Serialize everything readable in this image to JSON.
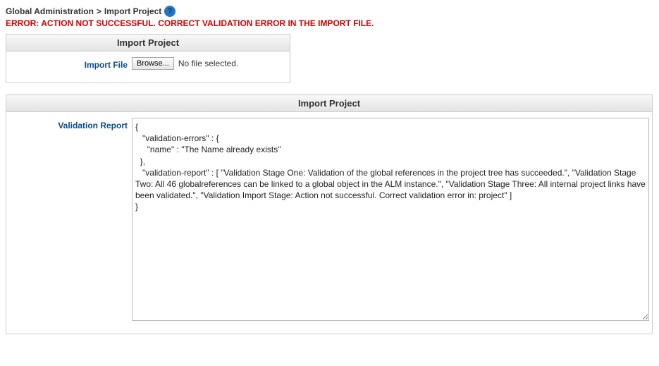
{
  "breadcrumb": {
    "parent": "Global Administration",
    "separator": ">",
    "current": "Import Project",
    "help_symbol": "?"
  },
  "error_message": "ERROR: ACTION NOT SUCCESSFUL. CORRECT VALIDATION ERROR IN THE IMPORT FILE.",
  "panel_import_file": {
    "title": "Import Project",
    "field_label": "Import File",
    "browse_label": "Browse...",
    "file_status": "No file selected."
  },
  "panel_validation": {
    "title": "Import Project",
    "field_label": "Validation Report",
    "report_text": "{\n   \"validation-errors\" : {\n     \"name\" : \"The Name already exists\"\n  },\n   \"validation-report\" : [ \"Validation Stage One: Validation of the global references in the project tree has succeeded.\", \"Validation Stage Two: All 46 globalreferences can be linked to a global object in the ALM instance.\", \"Validation Stage Three: All internal project links have been validated.\", \"Validation Import Stage: Action not successful. Correct validation error in: project\" ]\n}"
  }
}
